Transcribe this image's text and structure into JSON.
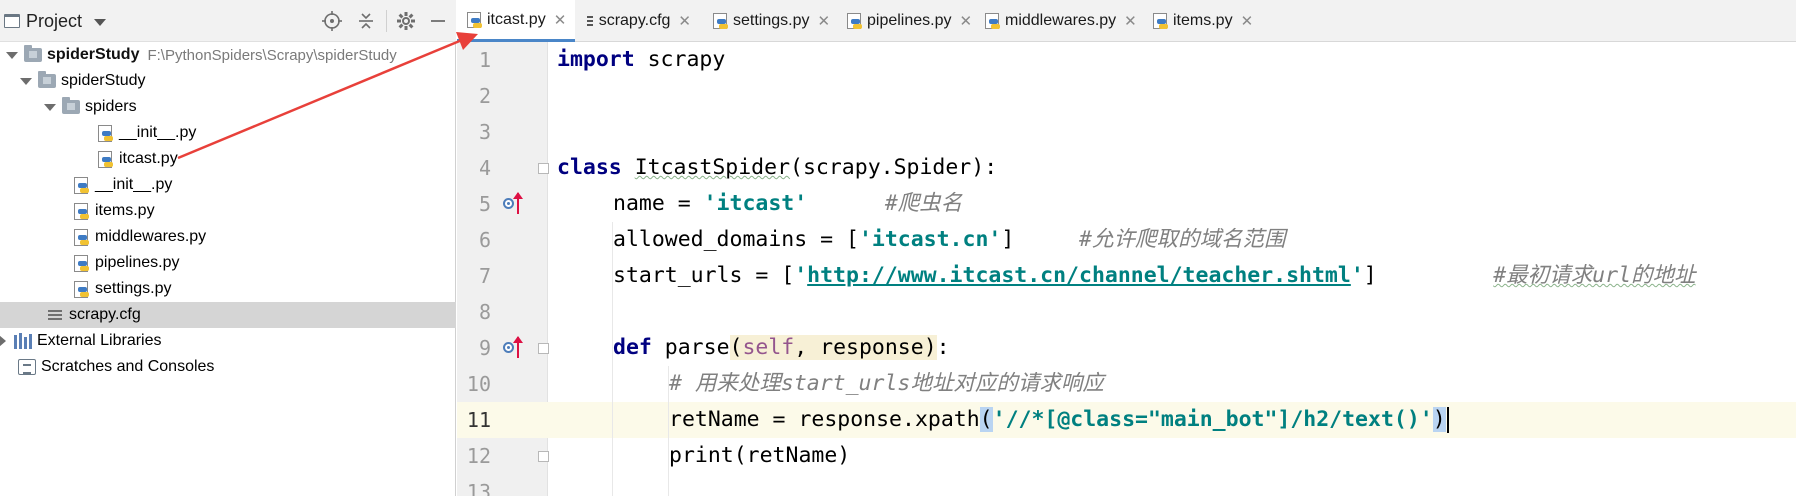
{
  "project_panel": {
    "title": "Project",
    "tree": [
      {
        "label": "spiderStudy",
        "path": "F:\\PythonSpiders\\Scrapy\\spiderStudy",
        "type": "folder",
        "expanded": true
      },
      {
        "label": "spiderStudy",
        "type": "package",
        "expanded": true
      },
      {
        "label": "spiders",
        "type": "folder",
        "expanded": true
      },
      {
        "label": "__init__.py",
        "type": "python"
      },
      {
        "label": "itcast.py",
        "type": "python"
      },
      {
        "label": "__init__.py",
        "type": "python"
      },
      {
        "label": "items.py",
        "type": "python"
      },
      {
        "label": "middlewares.py",
        "type": "python"
      },
      {
        "label": "pipelines.py",
        "type": "python"
      },
      {
        "label": "settings.py",
        "type": "python"
      },
      {
        "label": "scrapy.cfg",
        "type": "config",
        "selected": true
      },
      {
        "label": "External Libraries",
        "type": "library",
        "expanded": false
      },
      {
        "label": "Scratches and Consoles",
        "type": "scratch"
      }
    ]
  },
  "tabs": [
    {
      "label": "itcast.py",
      "active": true
    },
    {
      "label": "scrapy.cfg"
    },
    {
      "label": "settings.py"
    },
    {
      "label": "pipelines.py"
    },
    {
      "label": "middlewares.py"
    },
    {
      "label": "items.py"
    }
  ],
  "editor": {
    "line_numbers": [
      "1",
      "2",
      "3",
      "4",
      "5",
      "6",
      "7",
      "8",
      "9",
      "10",
      "11",
      "12",
      "13"
    ],
    "current_line": "11",
    "code": {
      "l1_kw": "import",
      "l1_rest": " scrapy",
      "l4_kw": "class",
      "l4_name": "ItcastSpider",
      "l4_rest": "(scrapy.Spider):",
      "l5_a": "name = ",
      "l5_str": "'itcast'",
      "l5_cm": "#爬虫名",
      "l6_a": "allowed_domains = [",
      "l6_str": "'itcast.cn'",
      "l6_b": "]",
      "l6_cm": "#允许爬取的域名范围",
      "l7_a": "start_urls = [",
      "l7_q1": "'",
      "l7_url": "http://www.itcast.cn/channel/teacher.shtml",
      "l7_q2": "'",
      "l7_b": "]",
      "l7_cm": "#最初请求url的地址",
      "l9_kw": "def",
      "l9_name": " parse",
      "l9_open": "(",
      "l9_self": "self",
      "l9_param": ", response",
      "l9_close": ")",
      "l9_colon": ":",
      "l10_cm": "# 用来处理start_urls地址对应的请求响应",
      "l11_a": "retName = response.xpath",
      "l11_open": "(",
      "l11_str": "'//*[@class=\"main_bot\"]/h2/text()'",
      "l11_close": ")",
      "l12_a": "print(retName)"
    }
  },
  "colors": {
    "keyword": "#000080",
    "string": "#008080",
    "comment": "#808080",
    "self": "#94558d",
    "annotation_arrow": "#e8403a",
    "active_tab_underline": "#4a86c8"
  },
  "icons": [
    "project-window-icon",
    "locate-icon",
    "collapse-icon",
    "gear-icon",
    "minimize-icon",
    "python-file-icon",
    "folder-icon",
    "config-file-icon",
    "library-icon",
    "scratch-icon",
    "override-marker-icon",
    "fold-icon"
  ]
}
